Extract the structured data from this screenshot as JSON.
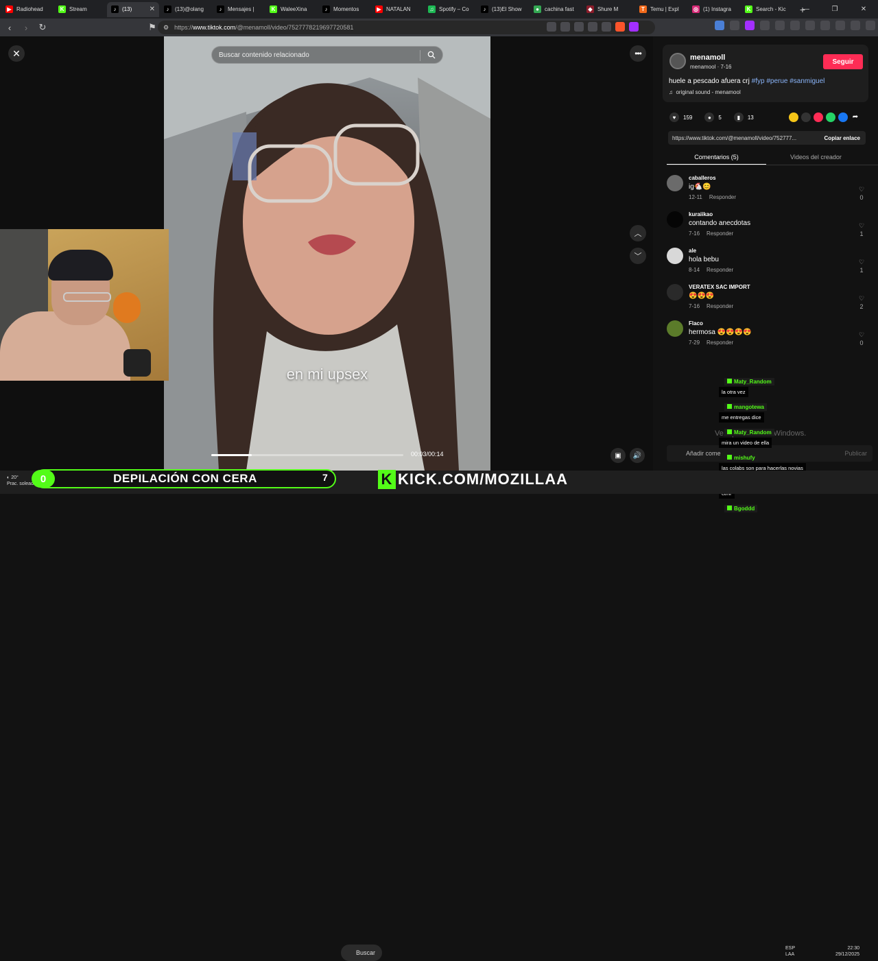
{
  "tabs": [
    {
      "label": "Radiohead",
      "color": "#ff0000",
      "glyph": "▶"
    },
    {
      "label": "Stream",
      "color": "#53fc18",
      "glyph": "K"
    },
    {
      "label": "(13)",
      "color": "#000000",
      "glyph": "♪",
      "active": true
    },
    {
      "label": "(13)@olang",
      "color": "#000000",
      "glyph": "♪"
    },
    {
      "label": "Mensajes |",
      "color": "#000000",
      "glyph": "♪"
    },
    {
      "label": "WaleeXina",
      "color": "#53fc18",
      "glyph": "K"
    },
    {
      "label": "Momentos",
      "color": "#000000",
      "glyph": "♪"
    },
    {
      "label": "NATALAN",
      "color": "#ff0000",
      "glyph": "▶"
    },
    {
      "label": "Spotify – Co",
      "color": "#1db954",
      "glyph": "♫"
    },
    {
      "label": "(13)El Show",
      "color": "#000000",
      "glyph": "♪"
    },
    {
      "label": "cachina fast",
      "color": "#34a853",
      "glyph": "●"
    },
    {
      "label": "Shure M",
      "color": "#8b1c2a",
      "glyph": "◆"
    },
    {
      "label": "Temu | Expl",
      "color": "#f26a1b",
      "glyph": "T"
    },
    {
      "label": "(1) Instagra",
      "color": "#d62976",
      "glyph": "◎"
    },
    {
      "label": "Search - Kic",
      "color": "#53fc18",
      "glyph": "K"
    }
  ],
  "url": {
    "prefix": "https://",
    "host": "www.tiktok.com",
    "path": "/@menamoll/video/7527778219697720581"
  },
  "video": {
    "search_placeholder": "Buscar contenido relacionado",
    "caption": "en mi upsex",
    "time": "00:03/00:14",
    "progress": 0.21
  },
  "post": {
    "username": "menamoll",
    "handle": "menamool · 7-16",
    "follow_label": "Seguir",
    "description": "huele a pescado afuera crj",
    "hashtags": [
      "#fyp",
      "#perue",
      "#sanmiguel"
    ],
    "sound": "original sound - menamool",
    "likes": "159",
    "comments": "5",
    "saves": "13",
    "link": "https://www.tiktok.com/@menamoll/video/752777...",
    "copy_label": "Copiar enlace",
    "tab_comments": "Comentarios (5)",
    "tab_creator": "Videos del creador",
    "add_comment_placeholder": "Añadir come",
    "publish_label": "Publicar"
  },
  "comments": [
    {
      "user": "caballeros",
      "text": "ig🐔😊",
      "date": "12-11",
      "reply": "Responder",
      "likes": "0",
      "avatar": "#6b6b6b"
    },
    {
      "user": "kuraiikao",
      "text": "contando anecdotas",
      "date": "7-16",
      "reply": "Responder",
      "likes": "1",
      "avatar": "#050505"
    },
    {
      "user": "ale",
      "text": "hola bebu",
      "date": "8-14",
      "reply": "Responder",
      "likes": "1",
      "avatar": "#d8d8d8"
    },
    {
      "user": "VERATEX SAC IMPORT",
      "text": "😍😍😍",
      "date": "7-16",
      "reply": "Responder",
      "likes": "2",
      "avatar": "#2a2a2a"
    },
    {
      "user": "Flaco",
      "text": "hermosa 😍😍😍😍",
      "date": "7-29",
      "reply": "Responder",
      "likes": "0",
      "avatar": "#5b7b2a"
    }
  ],
  "chat": [
    {
      "user": "Maty_Random",
      "msg": "la otra vez"
    },
    {
      "user": "mangotewa",
      "msg": "me entregas dice"
    },
    {
      "user": "Maty_Random",
      "msg": "mira un video de ella"
    },
    {
      "user": "mishufy",
      "msg": "las colabs son para hacerlas novias"
    },
    {
      "user": "Maty_Random",
      "msg": "ctmr"
    },
    {
      "user": "Bgoddd",
      "msg": ""
    }
  ],
  "watermark": "Ve... para activar Windows.",
  "overlay": {
    "banner": "DEPILACIÓN CON CERA",
    "ball": "0",
    "seven": "7",
    "kick": "KICK.COM/MOZILLAA"
  },
  "taskbar": {
    "weather_temp": "20°",
    "weather_desc": "Prac. soleado",
    "search": "Buscar",
    "lang1": "ESP",
    "lang2": "LAA",
    "time": "22:30",
    "date": "29/12/2025"
  }
}
